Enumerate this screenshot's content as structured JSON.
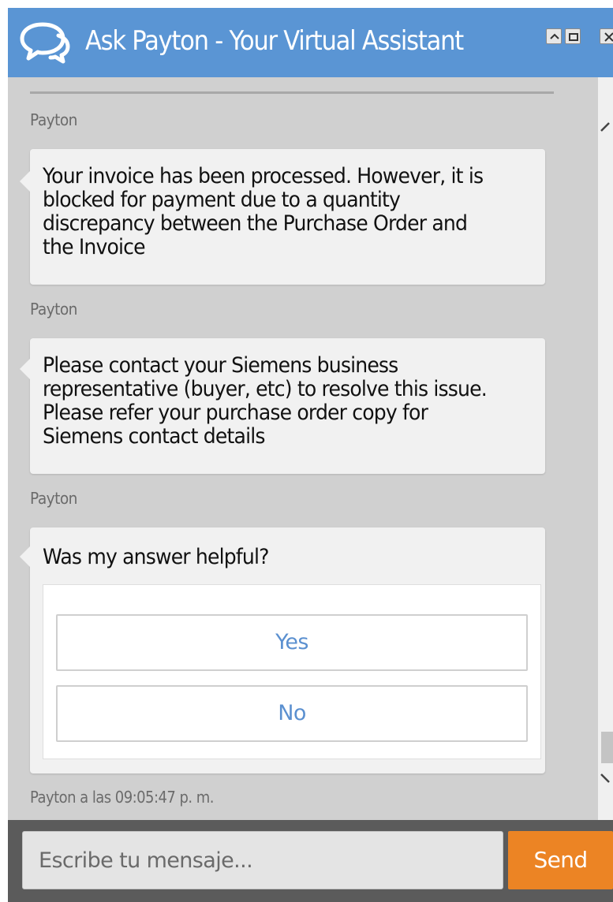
{
  "window": {
    "title": "Ask Payton - Your Virtual Assistant",
    "controls": [
      "minimize-icon",
      "maximize-icon",
      "close-icon"
    ]
  },
  "messages": [
    {
      "sender": "Payton",
      "lines": [
        "Your invoice has been processed. However, it is",
        "blocked for payment due to a quantity",
        "discrepancy between the Purchase Order and",
        "the Invoice"
      ]
    },
    {
      "sender": "Payton",
      "lines": [
        "Please contact your Siemens business",
        "representative (buyer, etc) to resolve this issue.",
        "Please refer your purchase order copy for",
        "Siemens contact details"
      ]
    },
    {
      "sender": "Payton",
      "question": "Was my answer helpful?",
      "options": [
        "Yes",
        "No"
      ]
    }
  ],
  "timestamp": "Payton a las 09:05:47 p. m.",
  "composer": {
    "placeholder": "Escribe tu mensaje...",
    "send_label": "Send"
  },
  "colors": {
    "header": "#5a95d4",
    "send_button": "#ec8424",
    "option_text": "#5b90d0",
    "background": "#d0d0d0"
  }
}
